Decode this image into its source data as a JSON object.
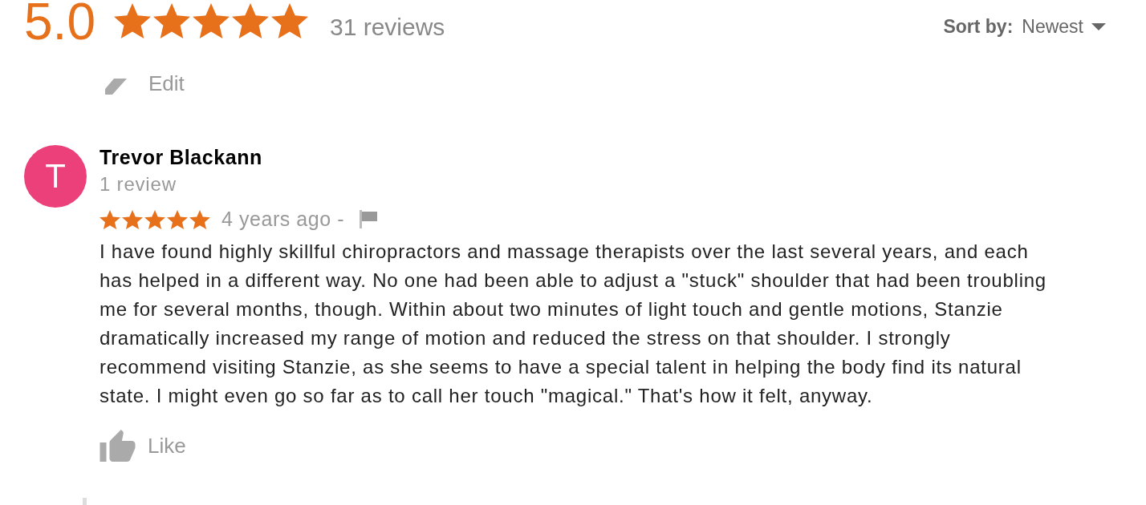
{
  "summary": {
    "rating": "5.0",
    "stars": 5,
    "count": "31 reviews"
  },
  "sort": {
    "label": "Sort by:",
    "value": "Newest"
  },
  "edit": {
    "label": "Edit"
  },
  "reviews": [
    {
      "initial": "T",
      "name": "Trevor Blackann",
      "review_count": "1 review",
      "stars": 5,
      "time": "4 years ago -",
      "text": "I have found highly skillful chiropractors and massage therapists over the last several years, and each has helped in a different way. No one had been able to adjust a \"stuck\" shoulder that had been troubling me for several months, though. Within about two minutes of light touch and gentle motions, Stanzie dramatically increased my range of motion and reduced the stress on that shoulder. I strongly recommend visiting Stanzie, as she seems to have a special talent in helping the body find its natural state. I might even go so far as to call her touch \"magical.\" That's how it felt, anyway.",
      "like": "Like"
    }
  ]
}
